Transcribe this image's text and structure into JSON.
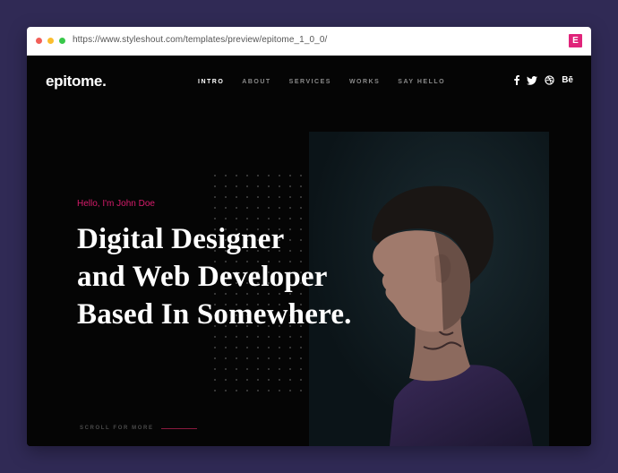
{
  "browser": {
    "url": "https://www.styleshout.com/templates/preview/epitome_1_0_0/",
    "extension_badge": "E"
  },
  "site": {
    "logo": "epitome.",
    "nav": [
      {
        "label": "INTRO",
        "active": true
      },
      {
        "label": "ABOUT",
        "active": false
      },
      {
        "label": "SERVICES",
        "active": false
      },
      {
        "label": "WORKS",
        "active": false
      },
      {
        "label": "SAY HELLO",
        "active": false
      }
    ],
    "social": [
      "facebook-icon",
      "twitter-icon",
      "dribbble-icon",
      "behance-icon"
    ],
    "behance_label": "Bē"
  },
  "hero": {
    "greeting": "Hello, I'm John Doe",
    "headline": [
      "Digital Designer",
      "and Web Developer",
      "Based In Somewhere."
    ],
    "scroll_label": "SCROLL FOR MORE"
  },
  "colors": {
    "background": "#302a55",
    "accent": "#d81c6c",
    "page": "#050505"
  }
}
